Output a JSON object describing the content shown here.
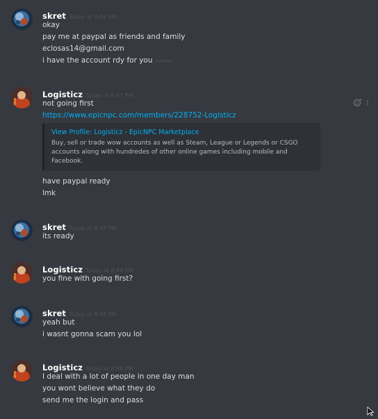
{
  "messages": [
    {
      "author": "skret",
      "timestamp": "Today at 8:46 PM",
      "lines": [
        "okay",
        "pay me at paypal as friends and family",
        "eclosas14@gmail.com",
        "i have the account rdy for you"
      ],
      "edited_label": "(edited)"
    },
    {
      "author": "Logisticz",
      "timestamp": "Today at 8:47 PM",
      "lines": [
        "not going first"
      ],
      "link": "https://www.epicnpc.com/members/228752-Logisticz",
      "embed": {
        "title": "View Profile: Logisticz - EpicNPC Marketplace",
        "description": "Buy, sell or trade wow accounts as well as Steam, League or Legends or CSGO accounts along with hundredes of other online games including mobile and Facebook."
      },
      "after_lines": [
        "have paypal ready",
        "lmk"
      ]
    },
    {
      "author": "skret",
      "timestamp": "Today at 8:48 PM",
      "lines": [
        "its ready"
      ]
    },
    {
      "author": "Logisticz",
      "timestamp": "Today at 8:48 PM",
      "lines": [
        "you fine with going first?"
      ]
    },
    {
      "author": "skret",
      "timestamp": "Today at 8:48 PM",
      "lines": [
        "yeah but",
        "i wasnt gonna scam you lol"
      ]
    },
    {
      "author": "Logisticz",
      "timestamp": "Today at 8:48 PM",
      "lines": [
        "I deal with a lot of people in one day man",
        "you wont believe what they do",
        "send me the login and pass"
      ]
    }
  ],
  "hover_icons": [
    "add-reaction-icon",
    "more-options-icon"
  ]
}
